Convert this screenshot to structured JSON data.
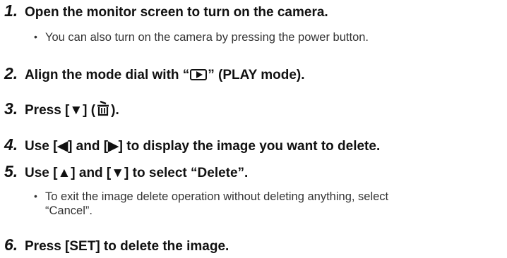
{
  "steps": [
    {
      "num": "1.",
      "text": "Open the monitor screen to turn on the camera.",
      "bullet": "You can also turn on the camera by pressing the power button."
    },
    {
      "num": "2.",
      "text_before": "Align the mode dial with “",
      "icon": "play-mode-icon",
      "text_after": "” (PLAY mode)."
    },
    {
      "num": "3.",
      "text_before": "Press [▼] (",
      "icon": "trash-icon",
      "text_after": ")."
    },
    {
      "num": "4.",
      "text": "Use [◀] and [▶] to display the image you want to delete."
    },
    {
      "num": "5.",
      "text": "Use [▲] and [▼] to select “Delete”.",
      "bullet_line1": "To exit the image delete operation without deleting anything, select",
      "bullet_line2": "“Cancel”."
    },
    {
      "num": "6.",
      "text": "Press [SET] to delete the image."
    }
  ],
  "bullet_char": "•"
}
